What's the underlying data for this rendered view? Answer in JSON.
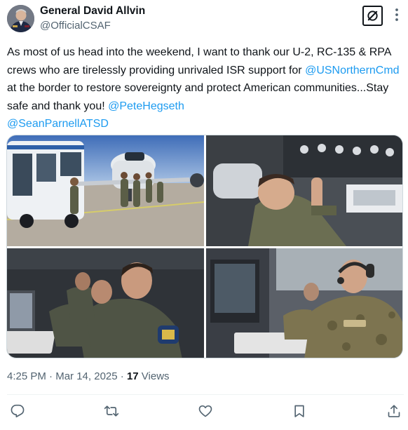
{
  "author": {
    "name": "General David Allvin",
    "handle": "@OfficialCSAF",
    "avatar_icon": "avatar-portrait"
  },
  "tweet": {
    "text_before": "As most of us head into the weekend, I want to thank our U-2, RC-135 & RPA crews who are tirelessly providing unrivaled ISR support for ",
    "mention_1": "@USNorthernCmd",
    "text_middle": " at the border to restore sovereignty and protect American communities...Stay safe and thank you! ",
    "mention_2": "@PeteHegseth",
    "mention_3": "@SeanParnellATSD"
  },
  "media": [
    {
      "icon": "photo-aircraft-ramp"
    },
    {
      "icon": "photo-cockpit-crew"
    },
    {
      "icon": "photo-isr-operators"
    },
    {
      "icon": "photo-console-operators"
    }
  ],
  "meta": {
    "time": "4:25 PM",
    "separator_1": " · ",
    "date": "Mar 14, 2025",
    "separator_2": " · ",
    "views_count": "17",
    "views_label": " Views"
  },
  "actions": {
    "reply_icon": "reply-icon",
    "retweet_icon": "retweet-icon",
    "like_icon": "heart-icon",
    "bookmark_icon": "bookmark-icon",
    "share_icon": "share-icon"
  },
  "colors": {
    "text": "#0f1419",
    "muted": "#536471",
    "link": "#1d9bf0",
    "border": "#cfd9de"
  }
}
